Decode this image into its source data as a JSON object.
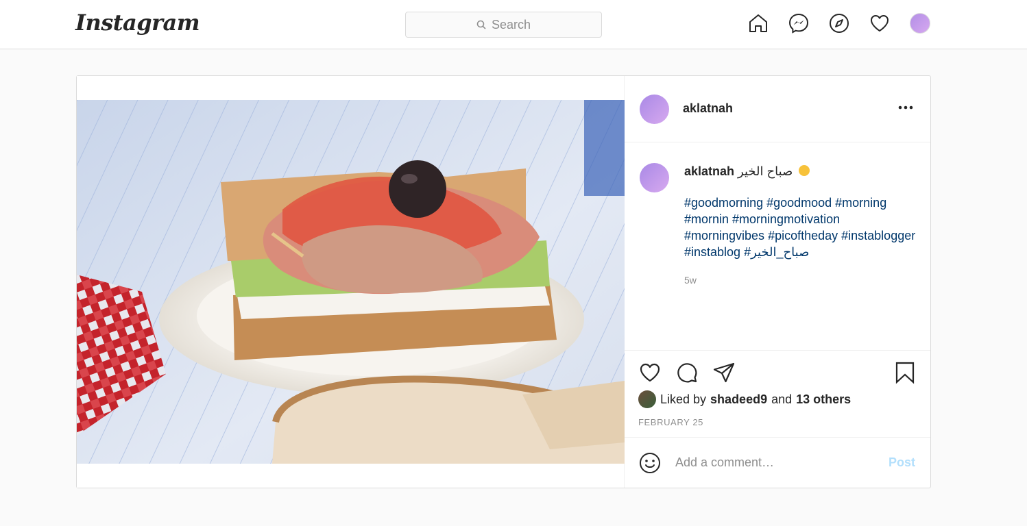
{
  "header": {
    "logo_text": "Instagram",
    "search_placeholder": "Search",
    "nav_icons": [
      "home-icon",
      "messenger-icon",
      "explore-icon",
      "activity-heart-icon",
      "profile-avatar"
    ]
  },
  "post": {
    "username": "aklatnah",
    "caption": {
      "username": "aklatnah",
      "text": "صباح الخير",
      "hashtags": "#goodmorning #goodmood #morning #mornin #morningmotivation #morningvibes #picoftheday #instablogger #instablog #صباح_الخير",
      "time_ago": "5w"
    },
    "likes": {
      "prefix": "Liked by",
      "user": "shadeed9",
      "and": "and",
      "others": "13 others"
    },
    "date": "FEBRUARY 25",
    "comment_placeholder": "Add a comment…",
    "post_button": "Post"
  },
  "colors": {
    "link": "#00376b",
    "muted": "#8e8e8e",
    "post_button_disabled": "#b2dffc"
  }
}
